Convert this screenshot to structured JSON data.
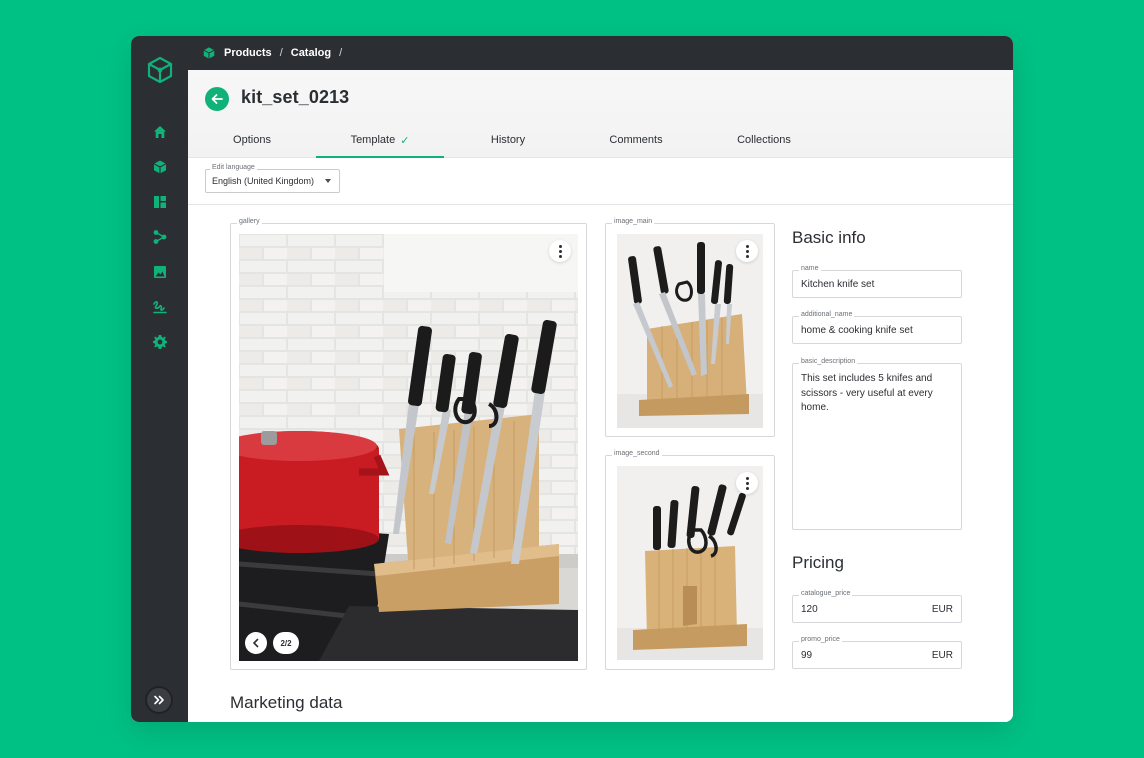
{
  "breadcrumb": {
    "items": [
      "Products",
      "Catalog"
    ],
    "separator": "/"
  },
  "page": {
    "title": "kit_set_0213"
  },
  "tabs": [
    {
      "label": "Options",
      "active": false
    },
    {
      "label": "Template",
      "active": true,
      "check": "✓"
    },
    {
      "label": "History",
      "active": false
    },
    {
      "label": "Comments",
      "active": false
    },
    {
      "label": "Collections",
      "active": false
    }
  ],
  "language": {
    "label": "Edit language",
    "value": "English (United Kingdom)"
  },
  "gallery": {
    "legend": "gallery",
    "counter": "2/2"
  },
  "image_main": {
    "legend": "image_main"
  },
  "image_second": {
    "legend": "image_second"
  },
  "basic_info": {
    "title": "Basic info",
    "name_label": "name",
    "name_value": "Kitchen knife set",
    "additional_label": "additional_name",
    "additional_value": "home & cooking knife set",
    "description_label": "basic_description",
    "description_value": "This set includes 5 knifes and scissors - very useful at every home."
  },
  "pricing": {
    "title": "Pricing",
    "catalogue_label": "catalogue_price",
    "catalogue_value": "120",
    "catalogue_unit": "EUR",
    "promo_label": "promo_price",
    "promo_value": "99",
    "promo_unit": "EUR"
  },
  "marketing": {
    "title": "Marketing data"
  },
  "colors": {
    "accent": "#10b27a",
    "background": "#00c184",
    "sidebar": "#2b2e33"
  },
  "icons": {
    "sidebar": [
      "home-icon",
      "product-cube-icon",
      "dashboard-icon",
      "workflow-icon",
      "image-icon",
      "signature-icon",
      "settings-gear-icon"
    ],
    "expand": "double-chevron-right-icon",
    "back": "arrow-left-icon"
  }
}
